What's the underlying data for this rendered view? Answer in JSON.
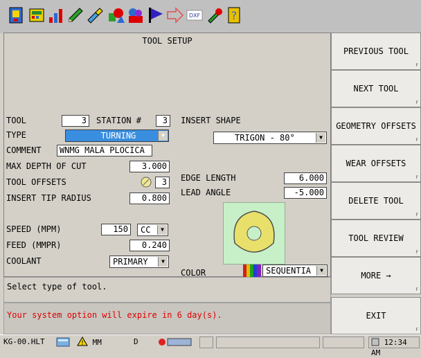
{
  "toolbar": {
    "icons": [
      "exit-icon",
      "calculator-icon",
      "chart-icon",
      "pencil-icon",
      "brush-icon",
      "shapes-icon",
      "user-icon",
      "flag-icon",
      "arrow-icon",
      "dxf-icon",
      "wrench-icon",
      "help-icon"
    ],
    "dxf_label": "DXF"
  },
  "page": {
    "title": "TOOL SETUP",
    "tool_label": "TOOL",
    "tool_value": "3",
    "station_label": "STATION #",
    "station_value": "3",
    "type_label": "TYPE",
    "type_value": "TURNING",
    "comment_label": "COMMENT",
    "comment_value": "WNMG MALA PLOCICA",
    "max_depth_label": "MAX DEPTH OF CUT",
    "max_depth_value": "3.000",
    "tool_offsets_label": "TOOL OFFSETS",
    "tool_offsets_value": "3",
    "insert_tip_label": "INSERT TIP RADIUS",
    "insert_tip_value": "0.800",
    "speed_label": "SPEED (MPM)",
    "speed_value": "150",
    "speed_unit": "CC",
    "feed_label": "FEED  (MMPR)",
    "feed_value": "0.240",
    "coolant_label": "COOLANT",
    "coolant_value": "PRIMARY",
    "insert_shape_label": "INSERT SHAPE",
    "insert_shape_value": "TRIGON - 80°",
    "edge_length_label": "EDGE LENGTH",
    "edge_length_value": "6.000",
    "lead_angle_label": "LEAD ANGLE",
    "lead_angle_value": "-5.000",
    "color_label": "COLOR",
    "color_value": "SEQUENTIA"
  },
  "side_buttons": [
    "PREVIOUS TOOL",
    "NEXT TOOL",
    "GEOMETRY OFFSETS",
    "WEAR OFFSETS",
    "DELETE TOOL",
    "TOOL REVIEW",
    "MORE →",
    "EXIT"
  ],
  "fkey_labels": [
    "F",
    "F",
    "F",
    "F",
    "F",
    "F",
    "F",
    "F"
  ],
  "messages": {
    "prompt": "Select type of tool.",
    "warning": "Your system option will expire in 6 day(s)."
  },
  "status": {
    "file": "KG-00.HLT",
    "mode": "MM",
    "drive": "D",
    "time": "12:34 AM"
  },
  "colors": {
    "warning": "#e00000",
    "selection": "#3a8ee0",
    "insert_bg": "#c8f0c8",
    "insert_fill": "#e8e06a"
  }
}
